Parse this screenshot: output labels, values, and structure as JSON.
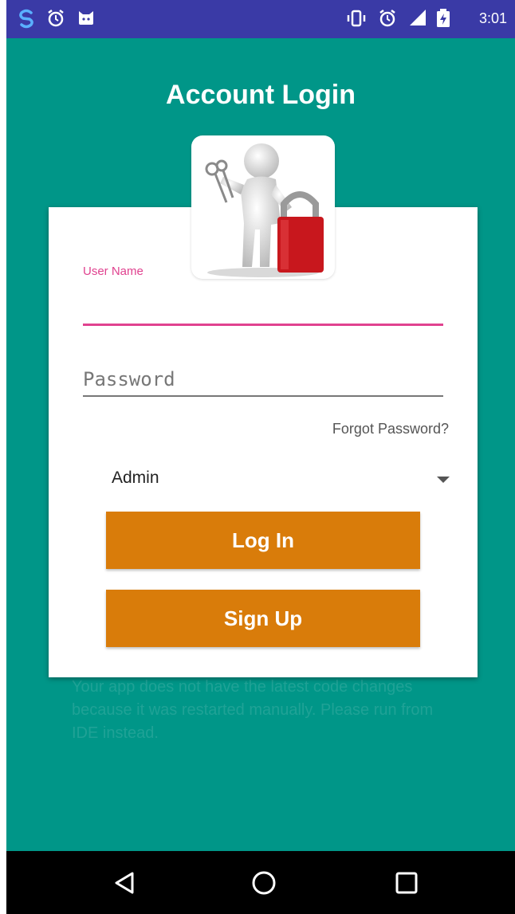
{
  "status_bar": {
    "time": "3:01",
    "left_icons": [
      "s-app-icon",
      "alarm-icon",
      "cat-app-icon"
    ],
    "right_icons": [
      "vibrate-icon",
      "alarm-icon",
      "signal-icon",
      "battery-icon"
    ],
    "bg_color": "#3a3aa6"
  },
  "screen": {
    "title": "Account Login",
    "bg_color": "#009688"
  },
  "form": {
    "username_label": "User Name",
    "username_value": "",
    "password_placeholder": "Password",
    "password_value": "",
    "forgot_password": "Forgot Password?",
    "role_selected": "Admin",
    "login_button": "Log In",
    "signup_button": "Sign Up",
    "accent_color": "#e0428f",
    "button_color": "#d97c0a"
  },
  "background_hint": "Your app does not have the latest code changes because it was restarted manually. Please run from IDE instead.",
  "nav_bar": {
    "icons": [
      "back-icon",
      "home-icon",
      "recents-icon"
    ]
  }
}
